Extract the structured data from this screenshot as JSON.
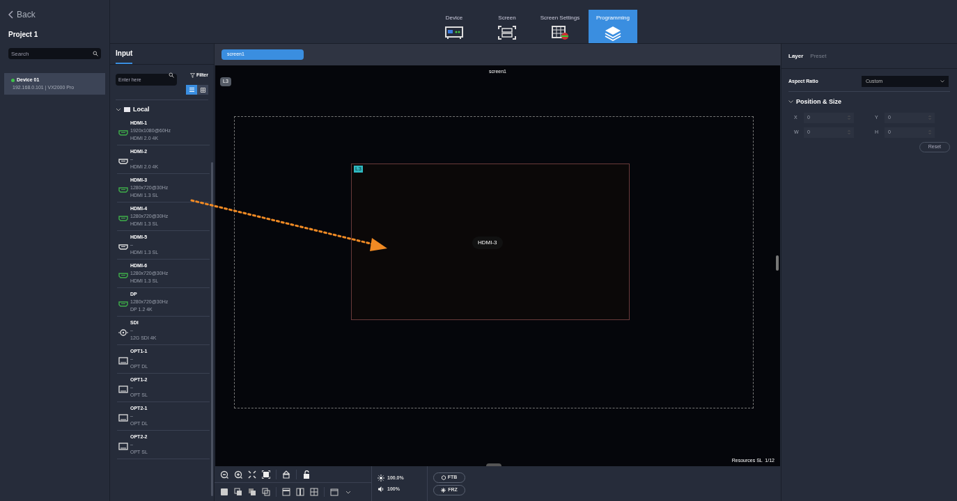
{
  "sidebar": {
    "back": "Back",
    "project": "Project 1",
    "search": {
      "placeholder": "Search"
    },
    "devices": [
      {
        "name": "Device 01",
        "detail": "192.168.0.101 | VX2000 Pro",
        "online": true,
        "selected": true
      }
    ]
  },
  "nav_tabs": [
    {
      "label": "Device",
      "kind": "device",
      "selected": false
    },
    {
      "label": "Screen",
      "kind": "screen",
      "selected": false
    },
    {
      "label": "Screen Settings",
      "kind": "settings",
      "selected": false
    },
    {
      "label": "Programming",
      "kind": "layers",
      "selected": true
    }
  ],
  "input_panel": {
    "tab": "Input",
    "search": {
      "placeholder": "Enter here"
    },
    "filter": "Filter",
    "views": [
      {
        "kind": "list",
        "selected": true
      },
      {
        "kind": "grid",
        "selected": false
      }
    ],
    "group": {
      "label": "Local",
      "expanded": true,
      "items": [
        {
          "name": "HDMI-1",
          "kind": "hdmi",
          "connected": true,
          "signal": "1920x1080@60Hz",
          "spec": "HDMI 2.0 4K"
        },
        {
          "name": "HDMI-2",
          "kind": "hdmi",
          "connected": false,
          "signal": "–",
          "spec": "HDMI 2.0 4K"
        },
        {
          "name": "HDMI-3",
          "kind": "hdmi",
          "connected": true,
          "signal": "1280x720@30Hz",
          "spec": "HDMI 1.3 SL"
        },
        {
          "name": "HDMI-4",
          "kind": "hdmi",
          "connected": true,
          "signal": "1280x720@30Hz",
          "spec": "HDMI 1.3 SL"
        },
        {
          "name": "HDMI-5",
          "kind": "hdmi",
          "connected": false,
          "signal": "–",
          "spec": "HDMI 1.3 SL"
        },
        {
          "name": "HDMI-6",
          "kind": "hdmi",
          "connected": true,
          "signal": "1280x720@30Hz",
          "spec": "HDMI 1.3 SL"
        },
        {
          "name": "DP",
          "kind": "hdmi",
          "connected": true,
          "signal": "1280x720@30Hz",
          "spec": "DP 1.2 4K"
        },
        {
          "name": "SDI",
          "kind": "sdi",
          "connected": false,
          "signal": "–",
          "spec": "12G SDI 4K"
        },
        {
          "name": "OPT1-1",
          "kind": "opt",
          "connected": false,
          "signal": "–",
          "spec": "OPT DL"
        },
        {
          "name": "OPT1-2",
          "kind": "opt",
          "connected": false,
          "signal": "–",
          "spec": "OPT SL"
        },
        {
          "name": "OPT2-1",
          "kind": "opt",
          "connected": false,
          "signal": "–",
          "spec": "OPT DL"
        },
        {
          "name": "OPT2-2",
          "kind": "opt",
          "connected": false,
          "signal": "–",
          "spec": "OPT SL"
        }
      ]
    }
  },
  "canvas": {
    "screen_tabs": [
      {
        "label": "screen1",
        "selected": true
      }
    ],
    "screen_title": "screen1",
    "layer_badge": "L3",
    "layer": {
      "badge": "L3",
      "source": "HDMI-3"
    },
    "resources": "Resources SL  1/12"
  },
  "toolbar": {
    "brightness": "100.0%",
    "volume": "100%",
    "buttons": [
      "FTB",
      "FRZ"
    ]
  },
  "properties": {
    "tabs": [
      {
        "label": "Layer",
        "selected": true
      },
      {
        "label": "Preset",
        "selected": false
      }
    ],
    "aspect_ratio": {
      "label": "Aspect Ratio",
      "value": "Custom"
    },
    "section": {
      "title": "Position & Size",
      "expanded": true,
      "fields": [
        {
          "label": "X",
          "value": "0",
          "disabled": true
        },
        {
          "label": "Y",
          "value": "0",
          "disabled": true
        },
        {
          "label": "W",
          "value": "0",
          "disabled": true
        },
        {
          "label": "H",
          "value": "0",
          "disabled": true
        }
      ],
      "reset": "Reset"
    }
  }
}
